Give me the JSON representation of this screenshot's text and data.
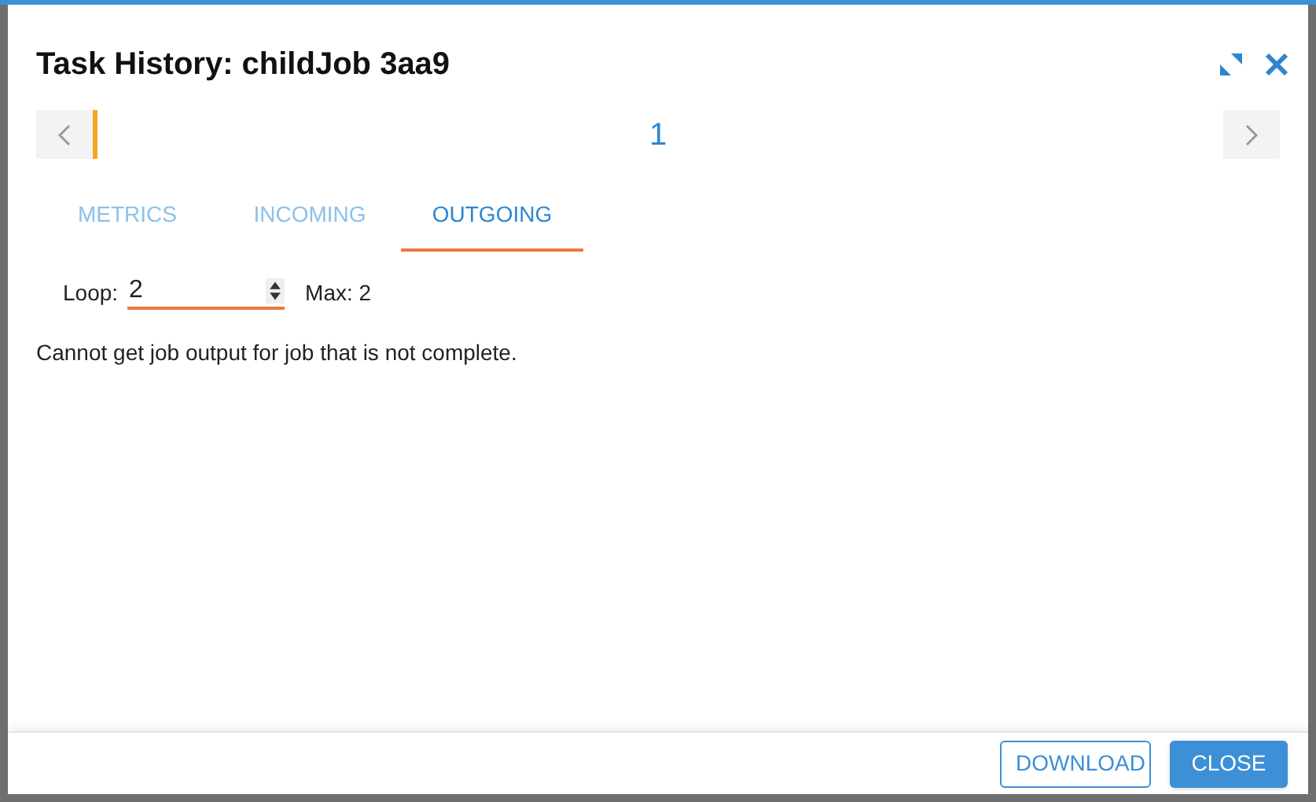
{
  "dialog": {
    "title": "Task History: childJob 3aa9"
  },
  "timeline": {
    "label": "1"
  },
  "tabs": [
    {
      "label": "METRICS",
      "selected": false
    },
    {
      "label": "INCOMING",
      "selected": false
    },
    {
      "label": "OUTGOING",
      "selected": true
    }
  ],
  "loop": {
    "label": "Loop:",
    "value": "2",
    "max": "Max: 2"
  },
  "message": "Cannot get job output for job that is not complete.",
  "buttons": [
    {
      "label": "DOWNLOAD",
      "kind": "outline"
    },
    {
      "label": "CLOSE",
      "kind": "primary"
    }
  ]
}
